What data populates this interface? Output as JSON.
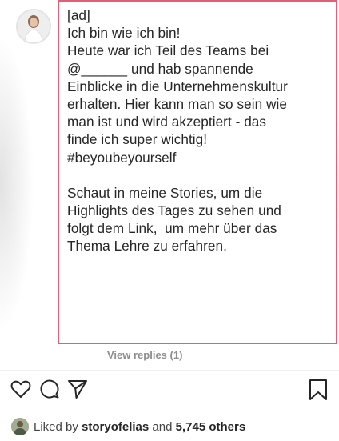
{
  "post": {
    "caption_lines": [
      "[ad]",
      "Ich bin wie ich bin!",
      "Heute war ich Teil des Teams bei",
      "@______ und hab spannende",
      "Einblicke in die Unternehmenskultur",
      "erhalten. Hier kann man so sein wie",
      "man ist und wird akzeptiert - das",
      "finde ich super wichtig!",
      "#beyoubeyourself",
      "",
      "Schaut in meine Stories, um die",
      "Highlights des Tages zu sehen und",
      "folgt dem Link,  um mehr über das",
      "Thema Lehre zu erfahren."
    ],
    "view_replies_label": "View replies (1)",
    "liked_prefix": "Liked by ",
    "liked_user": "storyofelias",
    "liked_middle": " and ",
    "liked_count": "5,745 others"
  },
  "icons": {
    "like": "heart-icon",
    "comment": "comment-icon",
    "share": "share-icon",
    "save": "bookmark-icon"
  },
  "colors": {
    "highlight_border": "#e0607a",
    "text": "#262626",
    "muted": "#8e8e8e"
  }
}
